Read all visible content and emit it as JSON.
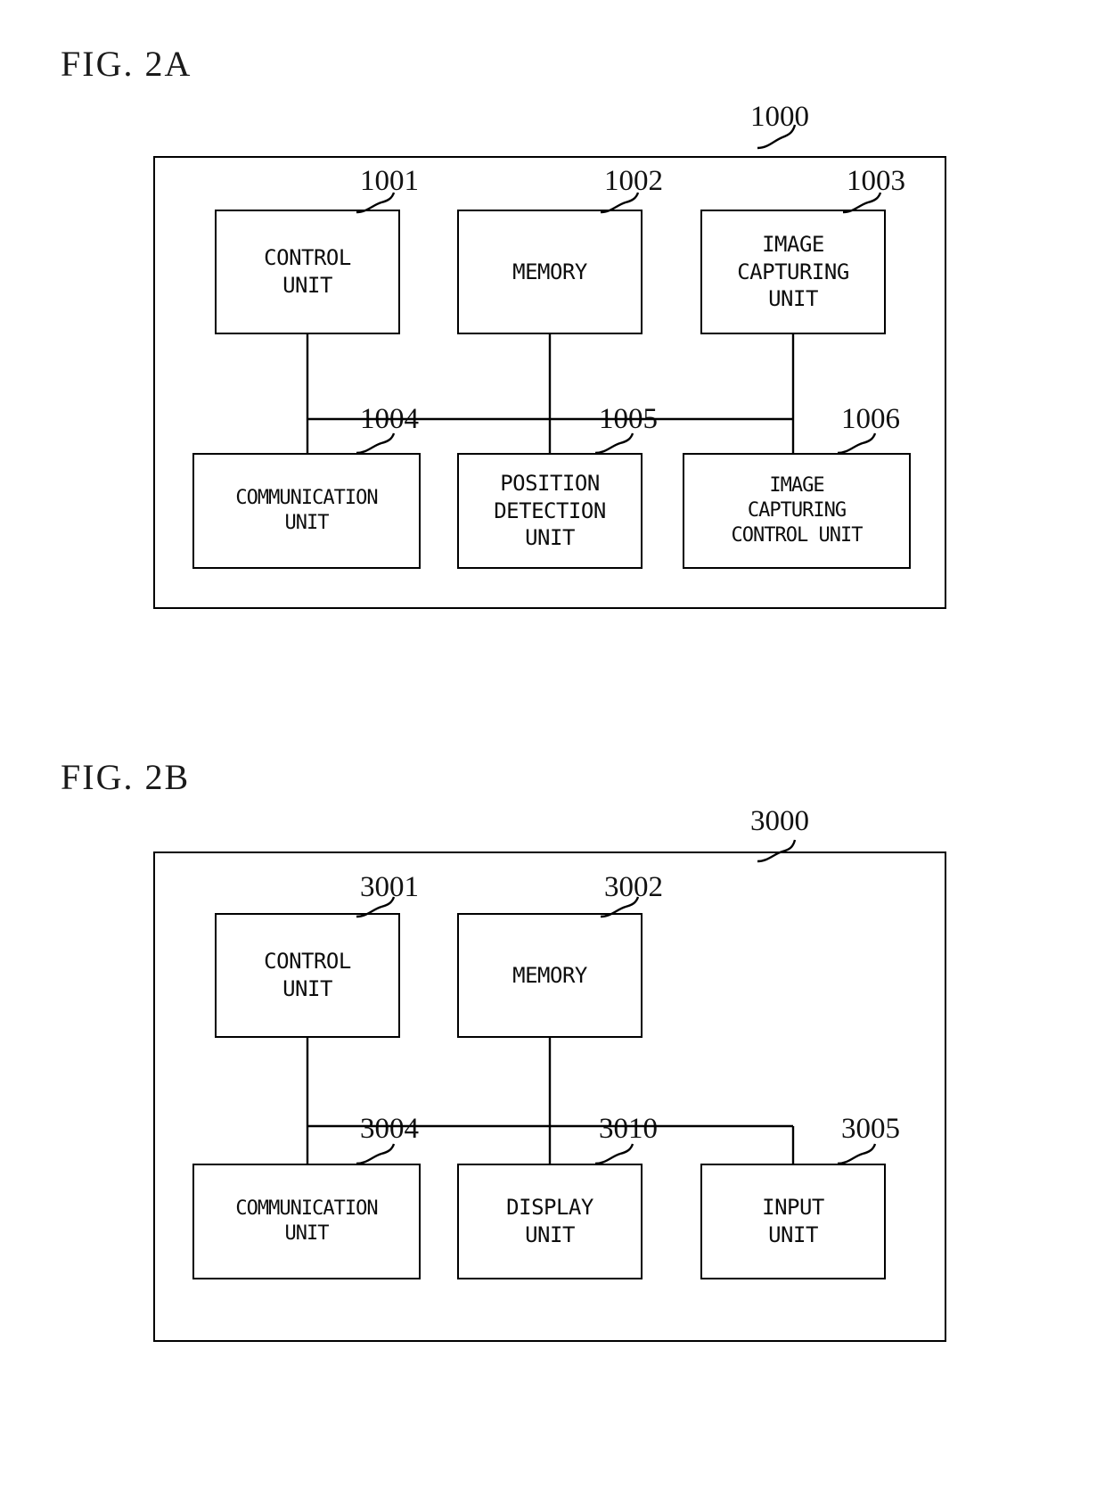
{
  "document": {
    "type": "patent-figure-sheet",
    "figures": [
      {
        "id": "fig-2a",
        "label": "FIG. 2A",
        "outer_ref": "1000",
        "boxes": [
          {
            "ref": "1001",
            "text": "CONTROL\nUNIT"
          },
          {
            "ref": "1002",
            "text": "MEMORY"
          },
          {
            "ref": "1003",
            "text": "IMAGE\nCAPTURING\nUNIT"
          },
          {
            "ref": "1004",
            "text": "COMMUNICATION\nUNIT"
          },
          {
            "ref": "1005",
            "text": "POSITION\nDETECTION\nUNIT"
          },
          {
            "ref": "1006",
            "text": "IMAGE\nCAPTURING\nCONTROL UNIT"
          }
        ]
      },
      {
        "id": "fig-2b",
        "label": "FIG. 2B",
        "outer_ref": "3000",
        "boxes": [
          {
            "ref": "3001",
            "text": "CONTROL\nUNIT"
          },
          {
            "ref": "3002",
            "text": "MEMORY"
          },
          {
            "ref": "3004",
            "text": "COMMUNICATION\nUNIT"
          },
          {
            "ref": "3010",
            "text": "DISPLAY\nUNIT"
          },
          {
            "ref": "3005",
            "text": "INPUT\nUNIT"
          }
        ]
      }
    ],
    "colors": {
      "ink": "#000000",
      "background": "#ffffff"
    }
  }
}
